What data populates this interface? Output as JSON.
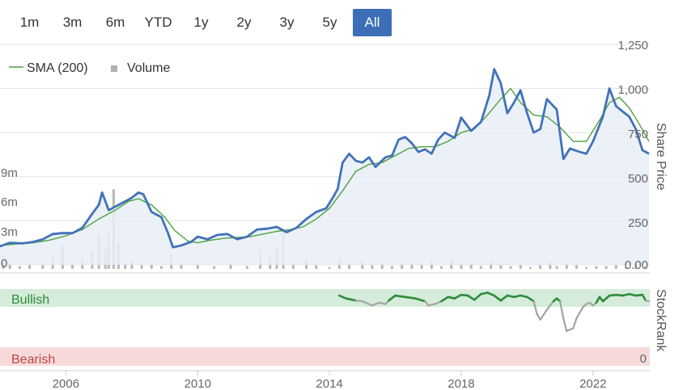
{
  "range_buttons": [
    {
      "label": "1m",
      "active": false
    },
    {
      "label": "3m",
      "active": false
    },
    {
      "label": "6m",
      "active": false
    },
    {
      "label": "YTD",
      "active": false
    },
    {
      "label": "1y",
      "active": false
    },
    {
      "label": "2y",
      "active": false
    },
    {
      "label": "3y",
      "active": false
    },
    {
      "label": "5y",
      "active": false
    },
    {
      "label": "All",
      "active": true
    }
  ],
  "legend": {
    "sma_label": "SMA (200)",
    "volume_label": "Volume"
  },
  "colors": {
    "price": "#4272b8",
    "sma": "#4ca23c",
    "bullish": "#2e8b3a",
    "bearish_text": "#c04545",
    "stockrank_neutral": "#a3a3a3",
    "accent": "#3d6fb8"
  },
  "chart_data": {
    "type": "line",
    "xlabel": "",
    "x_ticks": [
      "2006",
      "2010",
      "2014",
      "2018",
      "2022"
    ],
    "ylabel_right": "Share Price",
    "y_ticks_right": [
      "1,250",
      "1,000",
      "750",
      "500",
      "250",
      "0.00"
    ],
    "ylim": [
      0,
      1250
    ],
    "volume_ticks": [
      "9m",
      "6m",
      "3m",
      "0"
    ],
    "volume_ylim": [
      0,
      10.3
    ],
    "xlim": [
      2004.0,
      2023.7
    ],
    "series": [
      {
        "name": "Share Price",
        "points": [
          [
            2004.0,
            105
          ],
          [
            2004.3,
            125
          ],
          [
            2004.7,
            122
          ],
          [
            2005.0,
            130
          ],
          [
            2005.3,
            145
          ],
          [
            2005.6,
            175
          ],
          [
            2005.9,
            180
          ],
          [
            2006.2,
            180
          ],
          [
            2006.5,
            210
          ],
          [
            2006.8,
            290
          ],
          [
            2007.0,
            340
          ],
          [
            2007.1,
            410
          ],
          [
            2007.3,
            310
          ],
          [
            2007.5,
            330
          ],
          [
            2007.8,
            360
          ],
          [
            2008.0,
            380
          ],
          [
            2008.2,
            410
          ],
          [
            2008.35,
            400
          ],
          [
            2008.6,
            300
          ],
          [
            2008.9,
            270
          ],
          [
            2009.1,
            180
          ],
          [
            2009.25,
            100
          ],
          [
            2009.5,
            110
          ],
          [
            2009.8,
            130
          ],
          [
            2010.0,
            160
          ],
          [
            2010.3,
            145
          ],
          [
            2010.6,
            170
          ],
          [
            2010.9,
            175
          ],
          [
            2011.2,
            145
          ],
          [
            2011.5,
            160
          ],
          [
            2011.8,
            200
          ],
          [
            2012.1,
            205
          ],
          [
            2012.4,
            215
          ],
          [
            2012.7,
            185
          ],
          [
            2013.0,
            210
          ],
          [
            2013.3,
            260
          ],
          [
            2013.6,
            300
          ],
          [
            2013.9,
            320
          ],
          [
            2014.1,
            380
          ],
          [
            2014.25,
            430
          ],
          [
            2014.4,
            580
          ],
          [
            2014.6,
            630
          ],
          [
            2014.8,
            590
          ],
          [
            2015.0,
            580
          ],
          [
            2015.2,
            610
          ],
          [
            2015.4,
            555
          ],
          [
            2015.7,
            610
          ],
          [
            2015.9,
            620
          ],
          [
            2016.1,
            710
          ],
          [
            2016.3,
            725
          ],
          [
            2016.5,
            690
          ],
          [
            2016.7,
            640
          ],
          [
            2016.9,
            655
          ],
          [
            2017.1,
            630
          ],
          [
            2017.3,
            710
          ],
          [
            2017.5,
            750
          ],
          [
            2017.8,
            720
          ],
          [
            2018.0,
            835
          ],
          [
            2018.3,
            760
          ],
          [
            2018.6,
            810
          ],
          [
            2018.85,
            960
          ],
          [
            2019.0,
            1110
          ],
          [
            2019.2,
            1030
          ],
          [
            2019.4,
            860
          ],
          [
            2019.6,
            920
          ],
          [
            2019.8,
            990
          ],
          [
            2020.0,
            860
          ],
          [
            2020.2,
            750
          ],
          [
            2020.4,
            770
          ],
          [
            2020.6,
            940
          ],
          [
            2020.9,
            880
          ],
          [
            2021.1,
            600
          ],
          [
            2021.3,
            660
          ],
          [
            2021.6,
            640
          ],
          [
            2021.8,
            630
          ],
          [
            2022.0,
            700
          ],
          [
            2022.3,
            840
          ],
          [
            2022.5,
            1000
          ],
          [
            2022.7,
            900
          ],
          [
            2022.9,
            870
          ],
          [
            2023.1,
            840
          ],
          [
            2023.3,
            770
          ],
          [
            2023.5,
            650
          ],
          [
            2023.7,
            630
          ]
        ]
      },
      {
        "name": "SMA (200)",
        "points": [
          [
            2004.0,
            110
          ],
          [
            2004.5,
            118
          ],
          [
            2005.0,
            125
          ],
          [
            2005.5,
            140
          ],
          [
            2006.0,
            165
          ],
          [
            2006.5,
            200
          ],
          [
            2007.0,
            260
          ],
          [
            2007.5,
            310
          ],
          [
            2007.9,
            360
          ],
          [
            2008.2,
            375
          ],
          [
            2008.6,
            340
          ],
          [
            2009.0,
            270
          ],
          [
            2009.3,
            195
          ],
          [
            2009.7,
            135
          ],
          [
            2010.0,
            125
          ],
          [
            2010.4,
            140
          ],
          [
            2010.8,
            150
          ],
          [
            2011.2,
            155
          ],
          [
            2011.6,
            160
          ],
          [
            2012.0,
            175
          ],
          [
            2012.4,
            190
          ],
          [
            2012.8,
            200
          ],
          [
            2013.2,
            215
          ],
          [
            2013.6,
            260
          ],
          [
            2014.0,
            320
          ],
          [
            2014.4,
            420
          ],
          [
            2014.8,
            530
          ],
          [
            2015.2,
            570
          ],
          [
            2015.6,
            580
          ],
          [
            2016.0,
            620
          ],
          [
            2016.4,
            660
          ],
          [
            2016.8,
            670
          ],
          [
            2017.2,
            670
          ],
          [
            2017.6,
            700
          ],
          [
            2018.0,
            750
          ],
          [
            2018.4,
            770
          ],
          [
            2018.8,
            850
          ],
          [
            2019.2,
            940
          ],
          [
            2019.5,
            1000
          ],
          [
            2019.8,
            920
          ],
          [
            2020.2,
            850
          ],
          [
            2020.6,
            840
          ],
          [
            2021.0,
            780
          ],
          [
            2021.4,
            700
          ],
          [
            2021.8,
            700
          ],
          [
            2022.2,
            820
          ],
          [
            2022.5,
            920
          ],
          [
            2022.8,
            950
          ],
          [
            2023.1,
            890
          ],
          [
            2023.4,
            800
          ],
          [
            2023.7,
            700
          ]
        ]
      }
    ],
    "volume": [
      [
        2004.1,
        1.4
      ],
      [
        2004.3,
        0.7
      ],
      [
        2004.6,
        0.3
      ],
      [
        2004.9,
        0.6
      ],
      [
        2005.3,
        0.4
      ],
      [
        2005.6,
        1.3
      ],
      [
        2005.9,
        2.6
      ],
      [
        2006.2,
        0.5
      ],
      [
        2006.5,
        1.1
      ],
      [
        2006.8,
        1.9
      ],
      [
        2007.0,
        3.7
      ],
      [
        2007.2,
        2.1
      ],
      [
        2007.3,
        4.1
      ],
      [
        2007.45,
        8.6
      ],
      [
        2007.6,
        2.8
      ],
      [
        2007.8,
        0.6
      ],
      [
        2008.0,
        0.8
      ],
      [
        2008.3,
        0.4
      ],
      [
        2008.6,
        0.5
      ],
      [
        2008.9,
        0.3
      ],
      [
        2009.2,
        1.6
      ],
      [
        2009.5,
        0.4
      ],
      [
        2010.0,
        0.4
      ],
      [
        2010.5,
        0.3
      ],
      [
        2011.0,
        0.5
      ],
      [
        2011.5,
        0.3
      ],
      [
        2011.9,
        2.1
      ],
      [
        2012.2,
        1.4
      ],
      [
        2012.4,
        2.4
      ],
      [
        2012.6,
        4.2
      ],
      [
        2012.9,
        0.5
      ],
      [
        2013.3,
        1.0
      ],
      [
        2013.6,
        0.4
      ],
      [
        2014.0,
        0.2
      ],
      [
        2014.3,
        1.1
      ],
      [
        2014.6,
        0.5
      ],
      [
        2015.0,
        0.9
      ],
      [
        2015.3,
        0.4
      ],
      [
        2015.6,
        0.6
      ],
      [
        2015.9,
        0.3
      ],
      [
        2016.2,
        0.5
      ],
      [
        2016.5,
        0.7
      ],
      [
        2016.8,
        0.4
      ],
      [
        2017.1,
        1.0
      ],
      [
        2017.4,
        0.3
      ],
      [
        2017.7,
        1.1
      ],
      [
        2018.0,
        0.4
      ],
      [
        2018.3,
        0.5
      ],
      [
        2018.6,
        0.3
      ],
      [
        2018.9,
        0.9
      ],
      [
        2019.2,
        0.4
      ],
      [
        2019.5,
        0.3
      ],
      [
        2019.8,
        0.4
      ],
      [
        2020.1,
        0.2
      ],
      [
        2020.4,
        0.4
      ],
      [
        2020.7,
        0.8
      ],
      [
        2020.9,
        0.3
      ],
      [
        2021.2,
        0.5
      ],
      [
        2021.5,
        0.4
      ],
      [
        2021.8,
        0.2
      ],
      [
        2022.1,
        0.3
      ],
      [
        2022.4,
        0.3
      ],
      [
        2022.7,
        0.4
      ],
      [
        2023.0,
        0.2
      ],
      [
        2023.3,
        0.5
      ],
      [
        2023.6,
        0.3
      ]
    ],
    "stockrank_scale": {
      "ylim": [
        0,
        100
      ],
      "right_tick": "0",
      "bullish_label": "Bullish",
      "bearish_label": "Bearish",
      "ylabel": "StockRank"
    },
    "stockrank": [
      [
        2014.3,
        92
      ],
      [
        2014.5,
        88
      ],
      [
        2014.8,
        85
      ],
      [
        2015.0,
        84
      ],
      [
        2015.3,
        78
      ],
      [
        2015.5,
        82
      ],
      [
        2015.7,
        80
      ],
      [
        2015.8,
        85
      ],
      [
        2016.0,
        92
      ],
      [
        2016.3,
        90
      ],
      [
        2016.6,
        88
      ],
      [
        2016.9,
        84
      ],
      [
        2017.0,
        78
      ],
      [
        2017.2,
        80
      ],
      [
        2017.4,
        84
      ],
      [
        2017.6,
        90
      ],
      [
        2017.8,
        88
      ],
      [
        2018.0,
        93
      ],
      [
        2018.2,
        92
      ],
      [
        2018.4,
        86
      ],
      [
        2018.6,
        94
      ],
      [
        2018.8,
        96
      ],
      [
        2019.0,
        92
      ],
      [
        2019.2,
        85
      ],
      [
        2019.4,
        92
      ],
      [
        2019.6,
        90
      ],
      [
        2019.8,
        92
      ],
      [
        2020.0,
        90
      ],
      [
        2020.2,
        84
      ],
      [
        2020.3,
        66
      ],
      [
        2020.4,
        58
      ],
      [
        2020.6,
        72
      ],
      [
        2020.8,
        84
      ],
      [
        2020.9,
        88
      ],
      [
        2021.0,
        84
      ],
      [
        2021.1,
        60
      ],
      [
        2021.2,
        42
      ],
      [
        2021.4,
        46
      ],
      [
        2021.5,
        60
      ],
      [
        2021.7,
        76
      ],
      [
        2021.8,
        80
      ],
      [
        2021.9,
        82
      ],
      [
        2022.0,
        78
      ],
      [
        2022.1,
        82
      ],
      [
        2022.2,
        90
      ],
      [
        2022.3,
        84
      ],
      [
        2022.5,
        92
      ],
      [
        2022.7,
        93
      ],
      [
        2022.9,
        92
      ],
      [
        2023.1,
        94
      ],
      [
        2023.3,
        92
      ],
      [
        2023.5,
        93
      ],
      [
        2023.6,
        85
      ],
      [
        2023.7,
        84
      ]
    ]
  }
}
